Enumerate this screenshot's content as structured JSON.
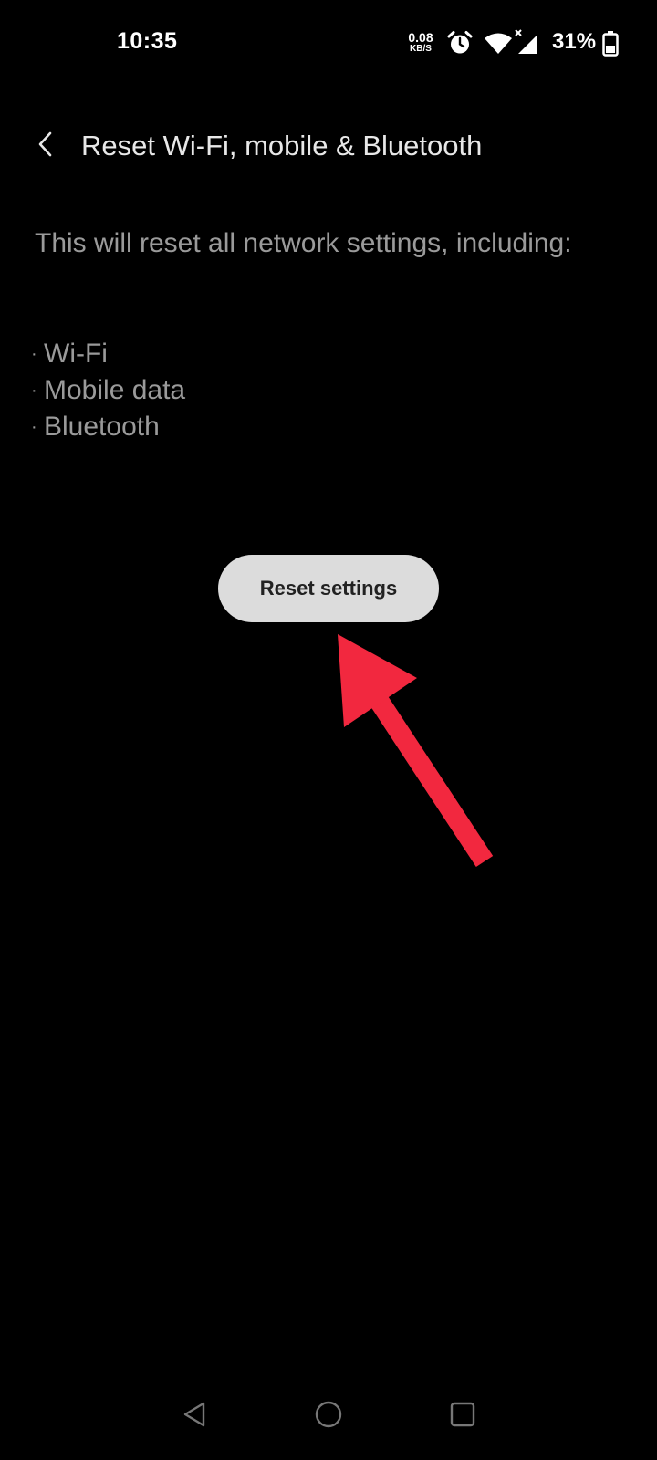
{
  "status_bar": {
    "time": "10:35",
    "net_speed_value": "0.08",
    "net_speed_unit": "KB/S",
    "battery_percent": "31%",
    "icons": [
      "alarm-icon",
      "wifi-icon",
      "signal-icon",
      "battery-icon"
    ]
  },
  "header": {
    "title": "Reset Wi-Fi, mobile & Bluetooth",
    "back_icon": "chevron-left-icon"
  },
  "content": {
    "description": "This will reset all network settings, including:",
    "items": [
      {
        "bullet": "·",
        "label": "Wi-Fi"
      },
      {
        "bullet": "·",
        "label": "Mobile data"
      },
      {
        "bullet": "·",
        "label": "Bluetooth"
      }
    ],
    "reset_button_label": "Reset settings"
  },
  "annotation": {
    "arrow_color": "#f2283f"
  },
  "nav_bar": {
    "icons": [
      "back-triangle-icon",
      "home-circle-icon",
      "recents-square-icon"
    ]
  },
  "colors": {
    "background": "#000000",
    "title_text": "#e8e8e8",
    "body_text": "#9a9a9a",
    "button_bg": "#dcdcdc",
    "button_text": "#222222"
  }
}
